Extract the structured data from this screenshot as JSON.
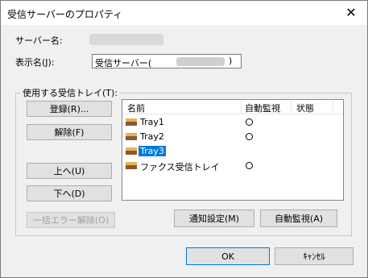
{
  "window": {
    "title": "受信サーバーのプロパティ",
    "close_symbol": "✕"
  },
  "server": {
    "label": "サーバー名:"
  },
  "display_name": {
    "label": "表示名(J):",
    "value_prefix": "受信サーバー(",
    "value_suffix": ")"
  },
  "trays_group": {
    "title": "使用する受信トレイ(T):"
  },
  "buttons": {
    "register": "登録(R)...",
    "release": "解除(F)",
    "up": "上へ(U)",
    "down": "下へ(D)",
    "clear_errors": "一括エラー解除(O)",
    "notify_settings": "通知設定(M)",
    "auto_monitor": "自動監視(A)",
    "ok": "OK",
    "cancel": "ｷｬﾝｾﾙ"
  },
  "list": {
    "columns": [
      "名前",
      "自動監視",
      "状態"
    ],
    "rows": [
      {
        "name": "Tray1",
        "auto_monitor": true,
        "selected": false
      },
      {
        "name": "Tray2",
        "auto_monitor": true,
        "selected": false
      },
      {
        "name": "Tray3",
        "auto_monitor": false,
        "selected": true
      },
      {
        "name": "ファクス受信トレイ",
        "auto_monitor": true,
        "selected": false
      }
    ]
  },
  "icons": {
    "tray": "inbox-tray-icon",
    "monitor_on": "circle-icon"
  },
  "colors": {
    "selection": "#0078d7",
    "tray_top": "#e8b15a",
    "tray_bottom": "#8b5a2b"
  }
}
